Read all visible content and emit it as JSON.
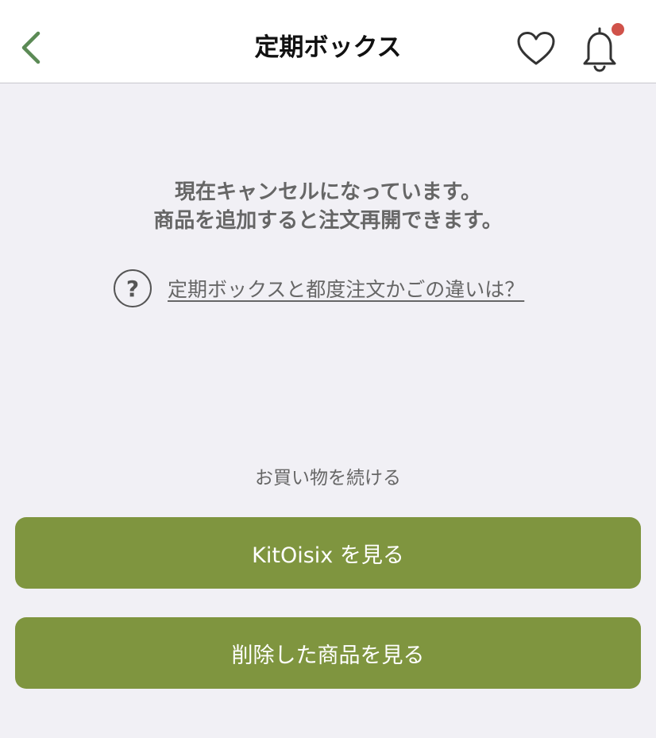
{
  "header": {
    "title": "定期ボックス",
    "back_icon": "chevron-left-icon",
    "favorite_icon": "heart-icon",
    "notification_icon": "bell-icon",
    "accent_color": "#5b8a55",
    "badge_color": "#d0524a"
  },
  "message": {
    "line1": "現在キャンセルになっています。",
    "line2": "商品を追加すると注文再開できます。"
  },
  "help": {
    "icon": "question-circle-icon",
    "icon_glyph": "?",
    "link_text": "定期ボックスと都度注文かごの違いは？"
  },
  "continue_shopping": {
    "label": "お買い物を続ける",
    "kitoisix_button": "KitOisix を見る",
    "deleted_button": "削除した商品を見る",
    "button_color": "#7f953f"
  }
}
